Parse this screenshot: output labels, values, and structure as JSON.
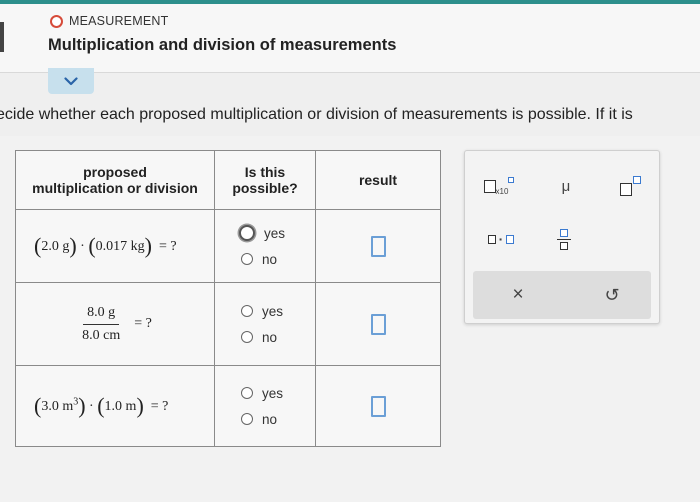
{
  "header": {
    "topic": "MEASUREMENT",
    "title": "Multiplication and division of measurements"
  },
  "instruction": "ecide whether each proposed multiplication or division of measurements is possible. If it is",
  "table": {
    "headers": {
      "proposed_line1": "proposed",
      "proposed_line2": "multiplication or division",
      "possible_line1": "Is this",
      "possible_line2": "possible?",
      "result": "result"
    },
    "rows": [
      {
        "a_num": "2.0",
        "a_unit": "g",
        "b_num": "0.017",
        "b_unit": "kg",
        "dot": "·",
        "equals": "=",
        "q": "?",
        "yes": "yes",
        "no": "no"
      },
      {
        "num": "8.0 g",
        "den": "8.0 cm",
        "equals": "=",
        "q": "?",
        "yes": "yes",
        "no": "no"
      },
      {
        "a_num": "3.0",
        "a_unit": "m",
        "a_exp": "3",
        "b_num": "1.0",
        "b_unit": "m",
        "dot": "·",
        "equals": "=",
        "q": "?",
        "yes": "yes",
        "no": "no"
      }
    ]
  },
  "palette": {
    "times10": "x10",
    "mu": "μ",
    "dot": "·",
    "clear": "×",
    "undo": "↺"
  },
  "colors": {
    "accent_teal": "#2d8f8c",
    "topic_circle": "#d64b3a",
    "answer_box": "#6b9fd6",
    "palette_blue": "#3b7ad0"
  },
  "icons": [
    "chevron-down-icon",
    "radio-button",
    "clear-icon",
    "undo-icon"
  ]
}
